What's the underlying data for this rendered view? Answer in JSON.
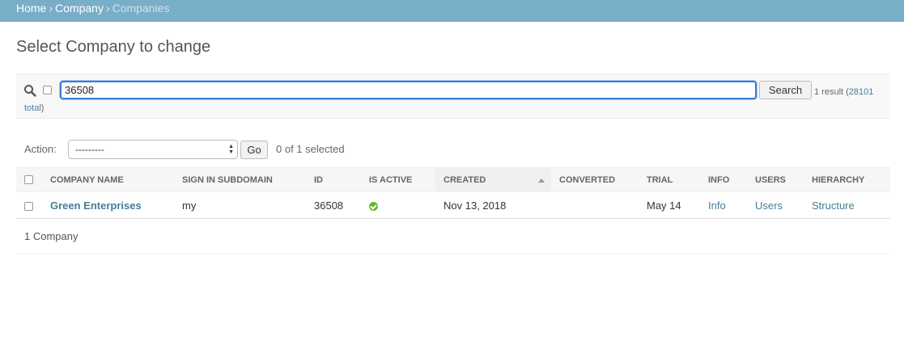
{
  "breadcrumbs": {
    "home": "Home",
    "separator": "›",
    "company": "Company",
    "current": "Companies"
  },
  "page": {
    "title": "Select Company to change"
  },
  "search": {
    "value": "36508",
    "button_label": "Search",
    "result_text": "1 result (",
    "total_link": "28101 total",
    "result_close": ")"
  },
  "actions": {
    "label": "Action:",
    "selected_value": "---------",
    "go_label": "Go",
    "selected_count": "0 of 1 selected"
  },
  "table": {
    "headers": [
      "Company name",
      "Sign in subdomain",
      "ID",
      "Is active",
      "Created",
      "Converted",
      "Trial",
      "Info",
      "Users",
      "Hierarchy"
    ],
    "rows": [
      {
        "company_name": "Green Enterprises",
        "subdomain": "my",
        "id": "36508",
        "is_active": true,
        "created": "Nov 13, 2018",
        "converted": "",
        "trial": "May 14",
        "info": "Info",
        "users": "Users",
        "hierarchy": "Structure"
      }
    ]
  },
  "paginator": {
    "text": "1 Company"
  },
  "colors": {
    "header_bar": "#79aec8",
    "link": "#447e9b",
    "active_icon": "#6ab42a",
    "focus_ring": "#3b7cd6"
  },
  "icons": {
    "search": "search-icon",
    "active": "check-circle-icon",
    "sort": "sort-ascending-icon",
    "select_arrows": "select-arrows-icon"
  }
}
